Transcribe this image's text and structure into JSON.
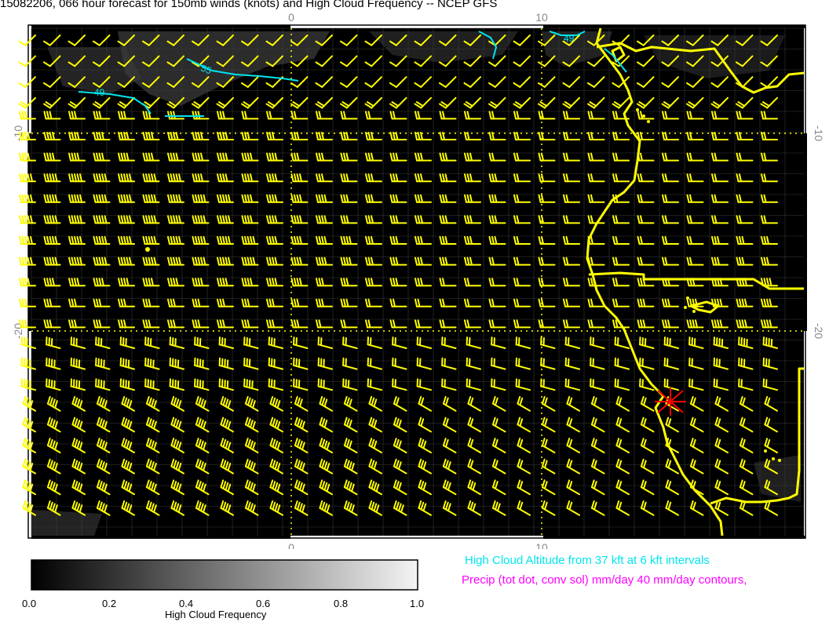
{
  "title": "15082206, 066 hour forecast for 150mb winds (knots) and High Cloud Frequency -- NCEP GFS",
  "map": {
    "x_axis_labels": [
      "0",
      "10"
    ],
    "y_axis_labels": [
      "-10",
      "-20"
    ],
    "contour_labels": [
      "55",
      "49",
      "49"
    ],
    "colors": {
      "background": "#000000",
      "wind_barbs": "#ffff00",
      "coastline": "#ffff00",
      "grid": "#ffff00",
      "cloud_altitude_contours": "#00e5ee",
      "station_marker": "#ff0000"
    },
    "wind_barb_rows": [
      {
        "dir": "NE",
        "kt": [
          10,
          10,
          10,
          10,
          10,
          10,
          10,
          10,
          10,
          10,
          10,
          10,
          10,
          10,
          10,
          10,
          10,
          10,
          10,
          10,
          10,
          10,
          10,
          10,
          10,
          10,
          10,
          10,
          10,
          10,
          10,
          10
        ]
      },
      {
        "dir": "NE",
        "kt": [
          10,
          10,
          10,
          10,
          10,
          10,
          10,
          10,
          10,
          10,
          10,
          10,
          10,
          10,
          10,
          10,
          10,
          10,
          10,
          10,
          10,
          10,
          10,
          10,
          10,
          10,
          10,
          10,
          10,
          10,
          10,
          10
        ]
      },
      {
        "dir": "NE",
        "kt": [
          10,
          10,
          10,
          10,
          10,
          10,
          10,
          10,
          10,
          10,
          10,
          10,
          10,
          10,
          10,
          10,
          10,
          10,
          10,
          10,
          10,
          10,
          10,
          10,
          10,
          10,
          10,
          10,
          10,
          10,
          10,
          10
        ]
      },
      {
        "dir": "NE",
        "kt": [
          20,
          20,
          20,
          20,
          20,
          20,
          20,
          20,
          20,
          20,
          20,
          20,
          20,
          20,
          20,
          20,
          20,
          20,
          20,
          20,
          20,
          20,
          20,
          20,
          20,
          20,
          20,
          20,
          20,
          20,
          20,
          20
        ]
      },
      {
        "dir": "E",
        "kt": [
          30,
          30,
          30,
          30,
          30,
          30,
          30,
          30,
          30,
          20,
          20,
          20,
          20,
          20,
          20,
          20,
          20,
          20,
          20,
          20,
          20,
          20,
          20,
          20,
          20,
          20,
          20,
          20,
          20,
          20,
          20,
          20
        ]
      },
      {
        "dir": "E",
        "kt": [
          40,
          40,
          40,
          40,
          40,
          40,
          40,
          40,
          40,
          30,
          30,
          30,
          30,
          30,
          30,
          30,
          30,
          20,
          20,
          20,
          20,
          20,
          20,
          20,
          20,
          20,
          20,
          20,
          20,
          20,
          20,
          20
        ]
      },
      {
        "dir": "E",
        "kt": [
          40,
          40,
          40,
          40,
          40,
          40,
          40,
          40,
          40,
          40,
          40,
          30,
          30,
          30,
          30,
          30,
          30,
          30,
          30,
          20,
          20,
          20,
          20,
          20,
          20,
          20,
          20,
          20,
          20,
          20,
          20,
          20
        ]
      },
      {
        "dir": "E",
        "kt": [
          50,
          50,
          50,
          50,
          50,
          50,
          50,
          40,
          40,
          40,
          40,
          40,
          30,
          30,
          30,
          30,
          30,
          30,
          30,
          30,
          20,
          20,
          20,
          20,
          20,
          20,
          20,
          20,
          20,
          20,
          20,
          20
        ]
      },
      {
        "dir": "E",
        "kt": [
          50,
          50,
          50,
          50,
          50,
          50,
          50,
          50,
          50,
          40,
          40,
          40,
          40,
          30,
          30,
          30,
          30,
          30,
          30,
          30,
          20,
          20,
          20,
          20,
          20,
          20,
          20,
          20,
          20,
          20,
          20,
          20
        ]
      },
      {
        "dir": "E",
        "kt": [
          50,
          50,
          50,
          50,
          50,
          50,
          50,
          50,
          50,
          40,
          40,
          40,
          40,
          30,
          30,
          30,
          30,
          30,
          30,
          30,
          20,
          20,
          20,
          20,
          20,
          20,
          20,
          20,
          20,
          20,
          20,
          20
        ]
      },
      {
        "dir": "E",
        "kt": [
          50,
          50,
          50,
          50,
          50,
          50,
          50,
          50,
          50,
          50,
          40,
          40,
          40,
          40,
          30,
          30,
          30,
          30,
          30,
          30,
          20,
          20,
          20,
          20,
          20,
          20,
          20,
          20,
          30,
          30,
          30,
          30
        ]
      },
      {
        "dir": "E",
        "kt": [
          50,
          50,
          50,
          50,
          50,
          50,
          50,
          50,
          50,
          50,
          40,
          40,
          40,
          40,
          30,
          30,
          30,
          30,
          30,
          20,
          20,
          20,
          20,
          20,
          20,
          20,
          20,
          20,
          30,
          30,
          30,
          30
        ]
      },
      {
        "dir": "E",
        "kt": [
          40,
          40,
          40,
          40,
          40,
          40,
          40,
          40,
          40,
          40,
          40,
          40,
          30,
          30,
          30,
          30,
          30,
          20,
          20,
          20,
          20,
          20,
          20,
          20,
          20,
          30,
          30,
          30,
          40,
          40,
          40,
          40
        ]
      },
      {
        "dir": "E",
        "kt": [
          30,
          30,
          30,
          30,
          30,
          30,
          30,
          30,
          30,
          30,
          30,
          30,
          30,
          30,
          20,
          20,
          20,
          20,
          20,
          20,
          20,
          20,
          20,
          20,
          20,
          30,
          30,
          40,
          40,
          40,
          40,
          40
        ]
      },
      {
        "dir": "E",
        "kt": [
          30,
          30,
          30,
          30,
          30,
          30,
          30,
          30,
          30,
          30,
          30,
          30,
          20,
          20,
          20,
          20,
          20,
          20,
          20,
          20,
          20,
          20,
          20,
          20,
          20,
          30,
          30,
          40,
          40,
          40,
          40,
          40
        ]
      },
      {
        "dir": "ESE",
        "kt": [
          30,
          30,
          30,
          30,
          30,
          30,
          30,
          30,
          30,
          30,
          30,
          20,
          20,
          20,
          20,
          20,
          20,
          20,
          20,
          20,
          20,
          20,
          20,
          20,
          20,
          30,
          30,
          30,
          40,
          40,
          40,
          40
        ]
      },
      {
        "dir": "ESE",
        "kt": [
          40,
          40,
          40,
          40,
          40,
          40,
          40,
          40,
          40,
          30,
          30,
          30,
          30,
          20,
          20,
          20,
          20,
          20,
          20,
          20,
          20,
          20,
          20,
          20,
          20,
          20,
          20,
          20,
          30,
          30,
          30,
          30
        ]
      },
      {
        "dir": "ESE",
        "kt": [
          40,
          40,
          40,
          40,
          40,
          40,
          40,
          40,
          40,
          40,
          30,
          30,
          30,
          30,
          20,
          20,
          20,
          20,
          20,
          20,
          20,
          20,
          20,
          20,
          20,
          20,
          20,
          20,
          20,
          20,
          20,
          20
        ]
      },
      {
        "dir": "SE",
        "kt": [
          40,
          40,
          40,
          40,
          40,
          40,
          40,
          40,
          40,
          40,
          40,
          30,
          30,
          30,
          30,
          20,
          20,
          20,
          20,
          20,
          20,
          20,
          20,
          20,
          20,
          20,
          20,
          20,
          20,
          20,
          20,
          20
        ]
      },
      {
        "dir": "SE",
        "kt": [
          40,
          40,
          40,
          40,
          40,
          40,
          40,
          40,
          40,
          40,
          40,
          40,
          30,
          30,
          30,
          30,
          20,
          20,
          20,
          20,
          20,
          20,
          20,
          20,
          20,
          20,
          20,
          20,
          20,
          20,
          20,
          20
        ]
      },
      {
        "dir": "SE",
        "kt": [
          40,
          40,
          40,
          40,
          40,
          40,
          40,
          40,
          40,
          40,
          40,
          40,
          40,
          30,
          30,
          30,
          30,
          20,
          20,
          20,
          20,
          20,
          20,
          20,
          20,
          20,
          20,
          20,
          20,
          20,
          20,
          20
        ]
      },
      {
        "dir": "SE",
        "kt": [
          40,
          40,
          40,
          40,
          40,
          40,
          40,
          40,
          40,
          40,
          40,
          40,
          40,
          40,
          30,
          30,
          30,
          30,
          20,
          20,
          20,
          20,
          20,
          20,
          20,
          20,
          20,
          20,
          20,
          20,
          20,
          20
        ]
      },
      {
        "dir": "SE",
        "kt": [
          40,
          40,
          40,
          40,
          40,
          40,
          40,
          40,
          40,
          40,
          40,
          40,
          40,
          40,
          40,
          30,
          30,
          30,
          30,
          20,
          20,
          20,
          20,
          20,
          20,
          20,
          20,
          20,
          20,
          20,
          20,
          20
        ]
      },
      {
        "dir": "SE",
        "kt": [
          40,
          40,
          40,
          40,
          40,
          40,
          40,
          40,
          40,
          40,
          40,
          40,
          40,
          40,
          40,
          40,
          30,
          30,
          30,
          30,
          20,
          20,
          20,
          20,
          20,
          20,
          20,
          20,
          20,
          20,
          20,
          20
        ]
      },
      {
        "dir": "SE",
        "kt": [
          40,
          40,
          40,
          40,
          40,
          40,
          40,
          40,
          40,
          40,
          40,
          40,
          40,
          40,
          40,
          40,
          40,
          30,
          30,
          30,
          30,
          20,
          20,
          20,
          20,
          20,
          20,
          20,
          20,
          20,
          20,
          20
        ]
      }
    ]
  },
  "colorbar": {
    "ticks": [
      "0.0",
      "0.2",
      "0.4",
      "0.6",
      "0.8",
      "1.0"
    ],
    "ticks_values": [
      0,
      0.2,
      0.4,
      0.6,
      0.8,
      1.0
    ],
    "label": "High Cloud Frequency"
  },
  "notes": {
    "cloud_altitude": "High Cloud Altitude from 37 kft at 6 kft intervals",
    "cloud_altitude_color": "#00e5ee",
    "precip": "Precip (tot dot, conv sol) mm/day 40 mm/day contours,",
    "precip_color": "#ff00ff"
  }
}
